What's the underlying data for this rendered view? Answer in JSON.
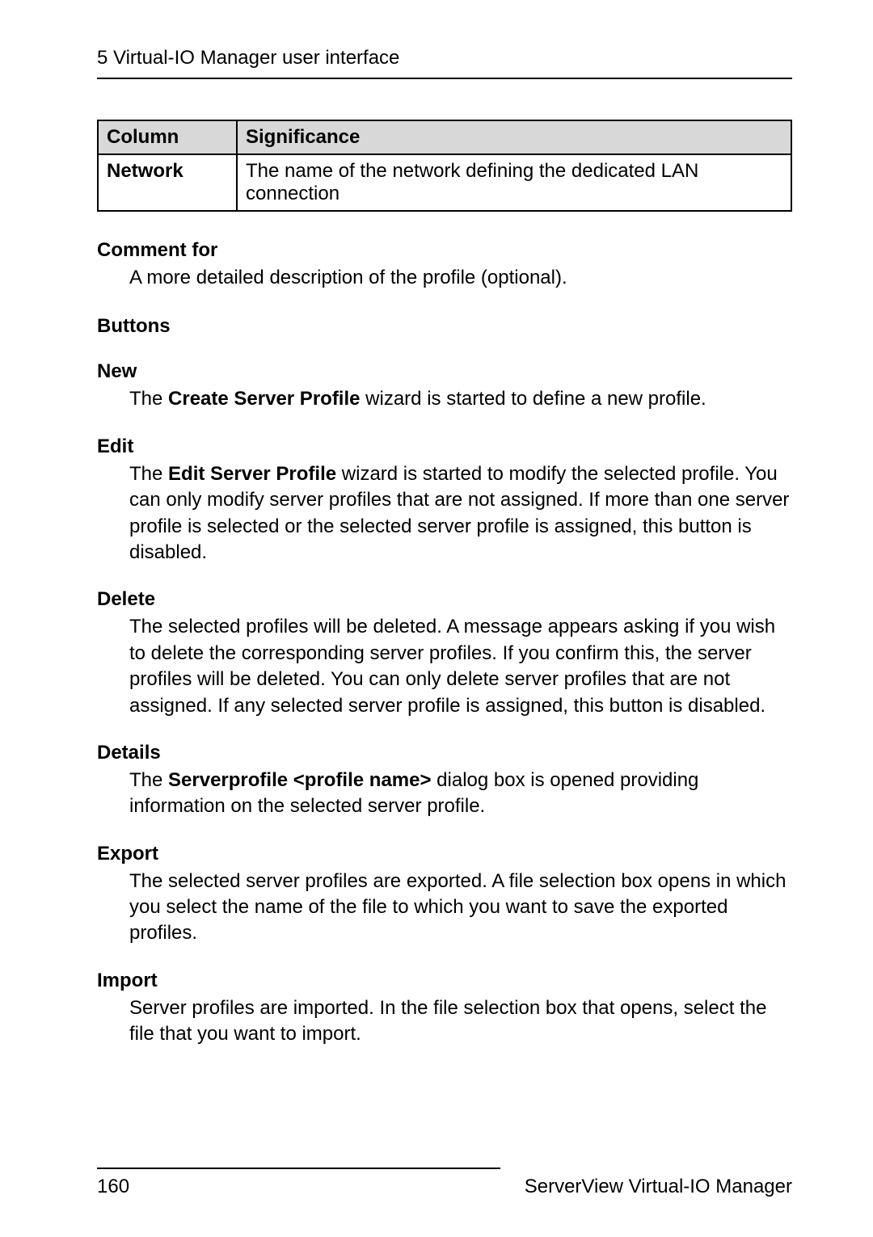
{
  "header": {
    "title": "5 Virtual-IO Manager user interface"
  },
  "table": {
    "columns": {
      "c1": "Column",
      "c2": "Significance"
    },
    "row": {
      "c1": "Network",
      "c2": "The name of the network defining the dedicated LAN connection"
    }
  },
  "items": {
    "comment_for": {
      "term": "Comment for",
      "desc": "A more detailed description of the profile (optional)."
    },
    "buttons_heading": "Buttons",
    "new": {
      "term": "New",
      "desc_pre": "The ",
      "desc_bold": "Create Server Profile",
      "desc_post": " wizard is started to define a new profile."
    },
    "edit": {
      "term": "Edit",
      "desc_pre": "The ",
      "desc_bold": "Edit Server Profile",
      "desc_post": " wizard is started to modify the selected profile. You can only modify server profiles that are not assigned. If more than one server profile is selected or the selected server profile is assigned, this button is disabled."
    },
    "delete": {
      "term": "Delete",
      "desc": "The selected profiles will be deleted. A message appears asking if you wish to delete the corresponding server profiles. If you confirm this, the server profiles will be deleted. You can only delete server profiles that are not assigned. If any selected server profile is assigned, this button is disabled."
    },
    "details": {
      "term": "Details",
      "desc_pre": "The ",
      "desc_bold": "Serverprofile <profile name>",
      "desc_post": " dialog box is opened providing information on the selected server profile."
    },
    "export": {
      "term": "Export",
      "desc": "The selected server profiles are exported. A file selection box opens in which you select the name of the file to which you want to save the exported profiles."
    },
    "import": {
      "term": "Import",
      "desc": "Server profiles are imported. In the file selection box that opens, select the file that you want to import."
    }
  },
  "footer": {
    "page": "160",
    "product": "ServerView Virtual-IO Manager"
  }
}
